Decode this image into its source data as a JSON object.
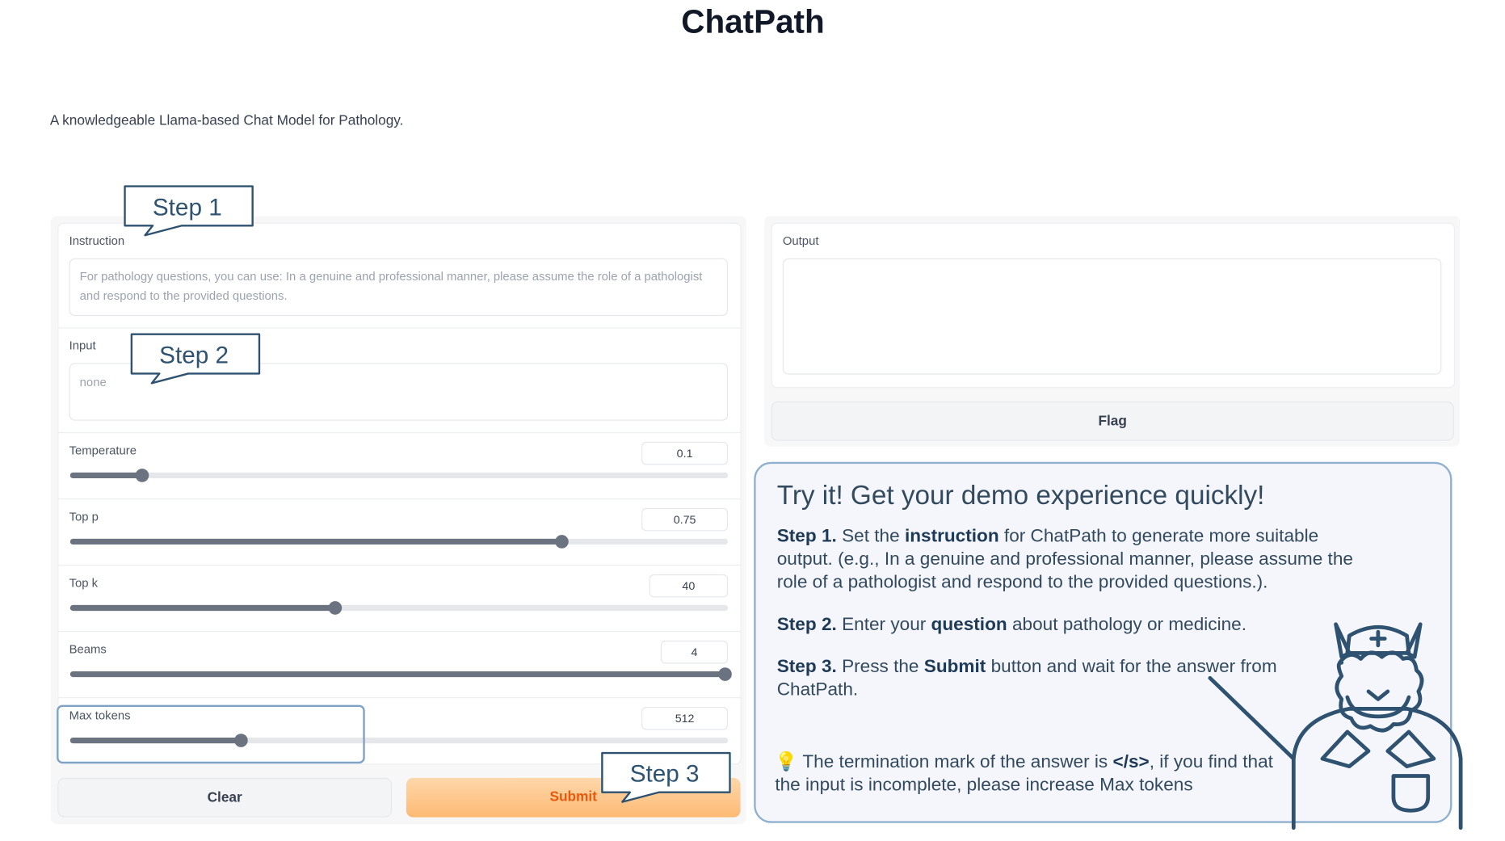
{
  "app": {
    "title": "ChatPath",
    "description": "A knowledgeable Llama-based Chat Model for Pathology."
  },
  "form": {
    "instruction": {
      "label": "Instruction",
      "placeholder": "For pathology questions, you can use: In a genuine and professional manner, please assume the role of a pathologist and respond to the provided questions."
    },
    "input": {
      "label": "Input",
      "placeholder": "none"
    },
    "sliders": [
      {
        "label": "Temperature",
        "value": "0.1",
        "fraction": 0.11
      },
      {
        "label": "Top p",
        "value": "0.75",
        "fraction": 0.747
      },
      {
        "label": "Top k",
        "value": "40",
        "fraction": 0.403
      },
      {
        "label": "Beams",
        "value": "4",
        "fraction": 0.995
      },
      {
        "label": "Max tokens",
        "value": "512",
        "fraction": 0.26
      }
    ],
    "clear_label": "Clear",
    "submit_label": "Submit"
  },
  "output": {
    "label": "Output",
    "value": "",
    "flag_label": "Flag"
  },
  "callouts": {
    "step1": "Step 1",
    "step2": "Step 2",
    "step3": "Step 3"
  },
  "demo": {
    "title": "Try it! Get your demo experience quickly!",
    "step1": {
      "prefix": "Step 1.",
      "t1": " Set the ",
      "bold": "instruction",
      "t2": " for ChatPath to generate more suitable output. (e.g., In a genuine and professional manner, please assume the role of a pathologist and respond to the provided questions.)."
    },
    "step2": {
      "prefix": "Step 2.",
      "t1": " Enter your ",
      "bold": "question",
      "t2": " about pathology or medicine."
    },
    "step3": {
      "prefix": "Step 3.",
      "t1": " Press the ",
      "bold": "Submit",
      "t2": " button and wait for the answer from ChatPath."
    },
    "note": {
      "icon": "💡",
      "t1": " The termination mark of the answer is ",
      "bold": "</s>",
      "t2": ", if you find that the input is incomplete, please increase Max tokens"
    }
  },
  "colors": {
    "accent": "#ea580c",
    "callout_border": "#2e5270",
    "slider": "#6b7280"
  },
  "icons": [
    "llama-doctor-mascot",
    "lightbulb-icon"
  ]
}
